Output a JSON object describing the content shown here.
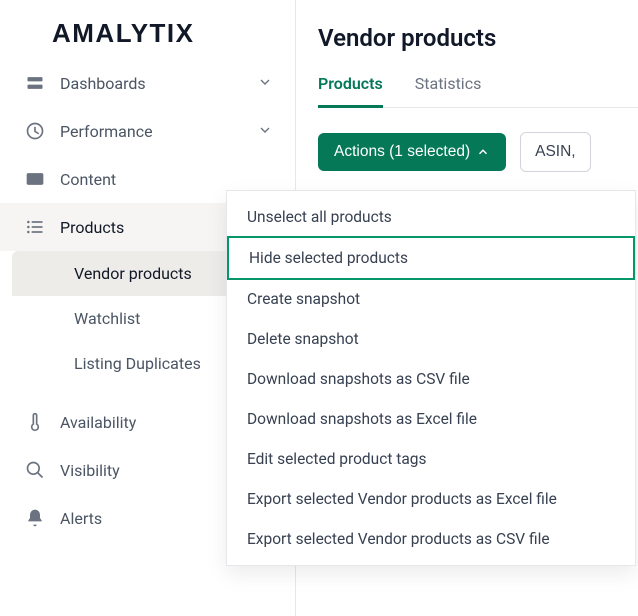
{
  "brand": "AMALYTIX",
  "sidebar": {
    "dashboards": "Dashboards",
    "performance": "Performance",
    "content": "Content",
    "products": "Products",
    "vendor_products": "Vendor products",
    "watchlist": "Watchlist",
    "listing_duplicates": "Listing Duplicates",
    "availability": "Availability",
    "visibility": "Visibility",
    "alerts": "Alerts"
  },
  "page": {
    "title": "Vendor products",
    "tabs": {
      "products": "Products",
      "statistics": "Statistics"
    },
    "actions_button": "Actions (1 selected)",
    "asin_button": "ASIN,"
  },
  "menu": {
    "unselect_all": "Unselect all products",
    "hide_selected": "Hide selected products",
    "create_snapshot": "Create snapshot",
    "delete_snapshot": "Delete snapshot",
    "download_csv": "Download snapshots as CSV file",
    "download_excel": "Download snapshots as Excel file",
    "edit_tags": "Edit selected product tags",
    "export_excel": "Export selected Vendor products as Excel file",
    "export_csv": "Export selected Vendor products as CSV file"
  }
}
